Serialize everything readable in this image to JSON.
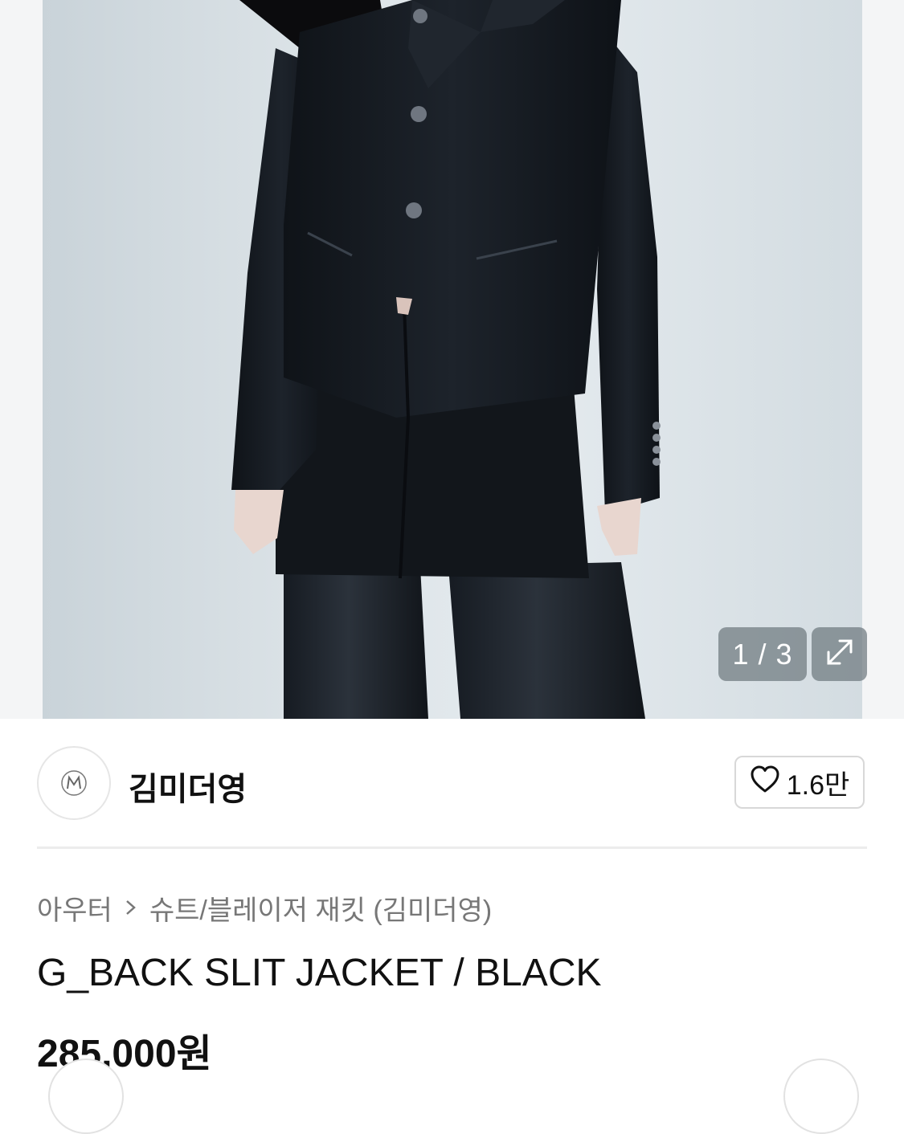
{
  "gallery": {
    "counter": "1 / 3",
    "current": 1,
    "total": 3,
    "expand_icon": "expand-icon"
  },
  "brand": {
    "logo_text": "ΒΜ",
    "name": "김미더영",
    "like_icon": "heart-icon",
    "like_count": "1.6만"
  },
  "product": {
    "breadcrumb": [
      "아우터",
      "슈트/블레이저 재킷 (김미더영)"
    ],
    "title": "G_BACK SLIT JACKET / BLACK",
    "price": "285,000원"
  },
  "colors": {
    "overlay": "#6e787e",
    "garment": "#15191f",
    "divider": "#ececec"
  }
}
